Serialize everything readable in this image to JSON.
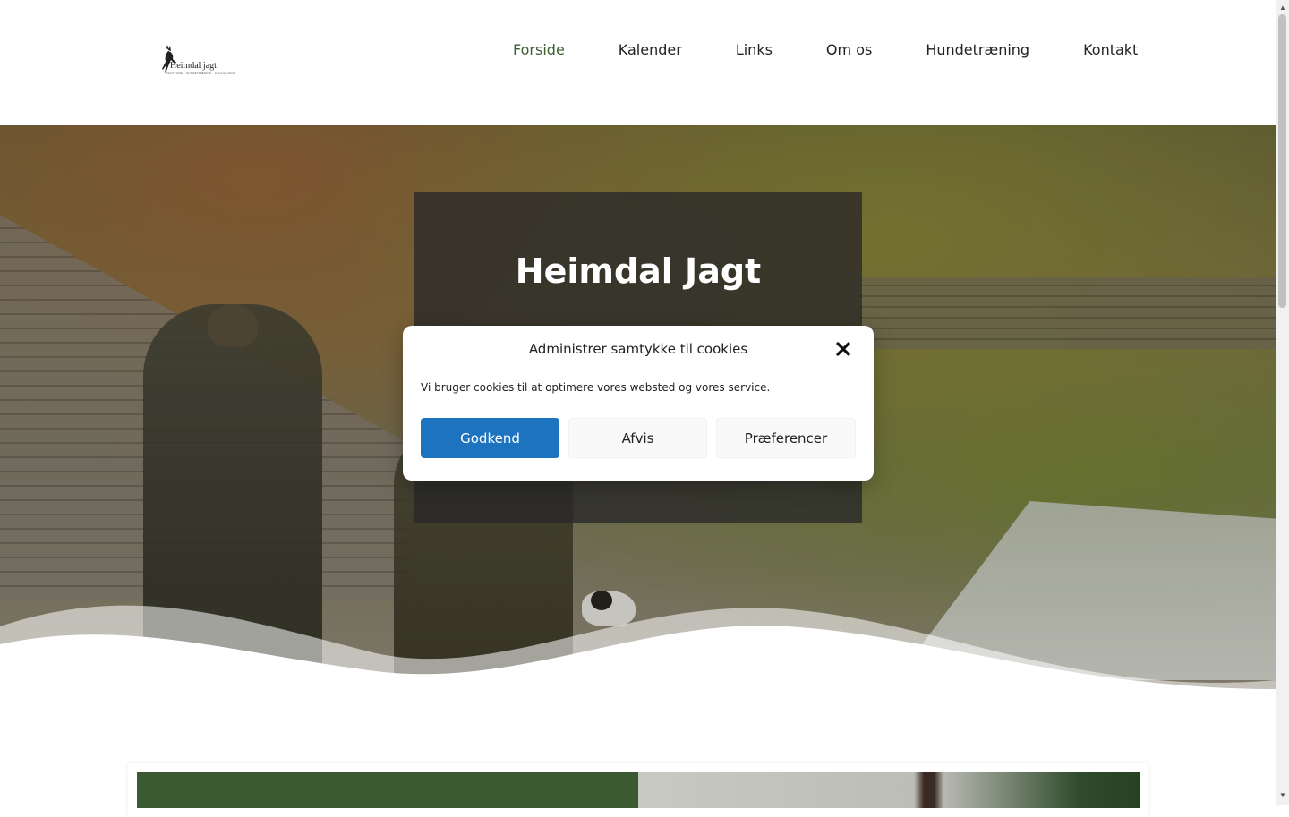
{
  "header": {
    "logo": {
      "name": "Heimdal jagt",
      "tagline": "JAGTTURE · HUNDETRÆNING · FÆLLESJAGT",
      "icon": "deer-icon"
    },
    "nav": [
      {
        "label": "Forside",
        "active": true
      },
      {
        "label": "Kalender",
        "active": false
      },
      {
        "label": "Links",
        "active": false
      },
      {
        "label": "Om os",
        "active": false
      },
      {
        "label": "Hundetræning",
        "active": false
      },
      {
        "label": "Kontakt",
        "active": false
      }
    ]
  },
  "hero": {
    "title": "Heimdal Jagt"
  },
  "cookie_modal": {
    "title": "Administrer samtykke til cookies",
    "text": "Vi bruger cookies til at optimere vores websted og vores service.",
    "buttons": {
      "accept": "Godkend",
      "deny": "Afvis",
      "preferences": "Præferencer"
    },
    "close_icon": "close-icon"
  },
  "colors": {
    "nav_active": "#3d5e30",
    "accept_button": "#1e73be",
    "card_green": "#3c5a32"
  }
}
